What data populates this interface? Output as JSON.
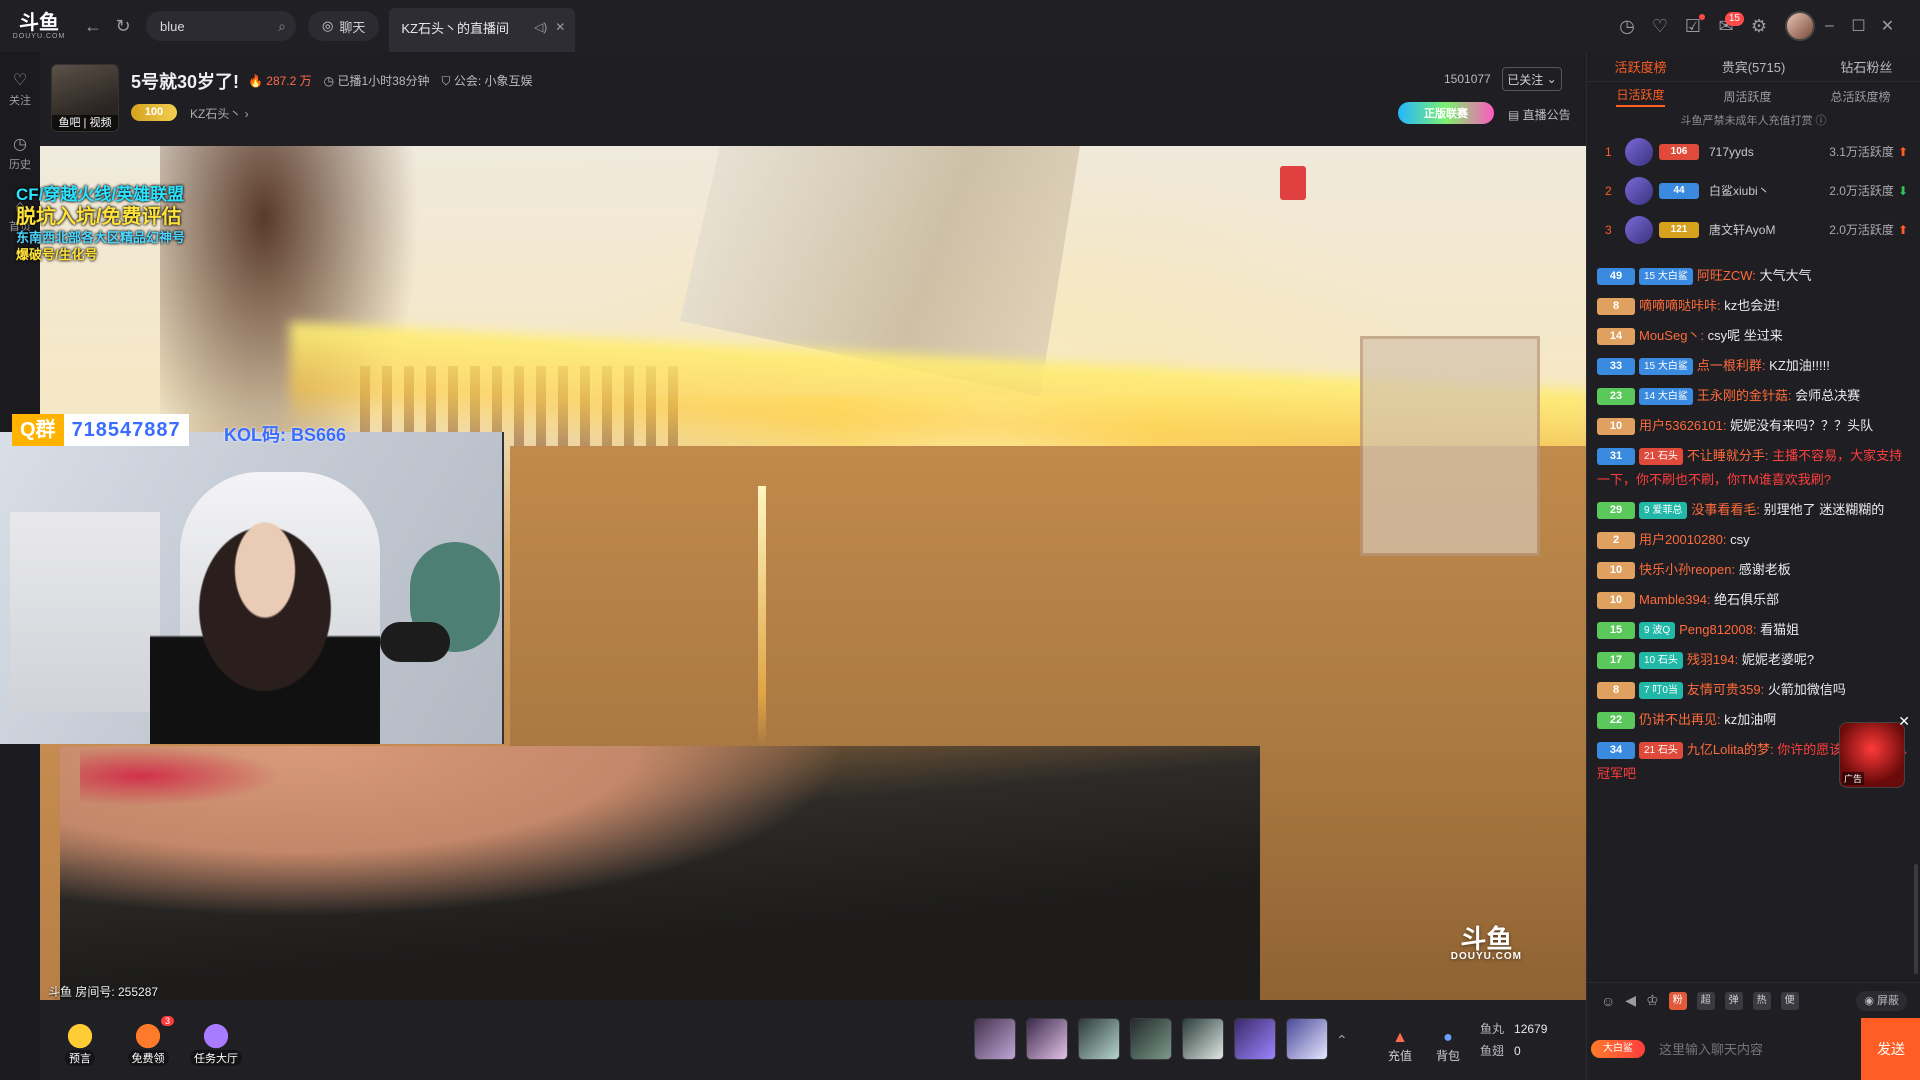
{
  "app": {
    "logo_text": "斗鱼",
    "logo_sub": "DOUYU.COM"
  },
  "topbar": {
    "search_value": "blue",
    "chat_label": "聊天",
    "tab_title": "KZ石头丶的直播间",
    "message_badge": "15"
  },
  "leftrail": [
    {
      "label": "关注",
      "icon": "heart-icon",
      "glyph": "♡"
    },
    {
      "label": "历史",
      "icon": "clock-icon",
      "glyph": "◷"
    },
    {
      "label": "首页",
      "icon": "home-icon",
      "glyph": "⌂"
    }
  ],
  "room": {
    "avatar_caption": "鱼吧 | 视频",
    "title": "5号就30岁了!",
    "hot": "287.2 万",
    "live_duration": "已播1小时38分钟",
    "guild": "公会: 小象互娱",
    "level": "100",
    "anchor": "KZ石头丶",
    "fans_count": "1501077",
    "follow_label": "已关注",
    "promo_label": "正版联赛",
    "notice_label": "直播公告",
    "room_number": "斗鱼 房间号: 255287"
  },
  "overlay": {
    "line1": "CF/穿越火线/英雄联盟",
    "line2": "脱坑入坑/免费评估",
    "line3": "东南西北部各大区精品幻神号",
    "line4": "爆破号/生化号",
    "qq_label": "Q群",
    "qq_number": "718547887",
    "kol": "KOL码: BS666"
  },
  "watermark": {
    "main": "斗鱼",
    "sub": "DOUYU.COM"
  },
  "giftbar": {
    "left": [
      {
        "label": "预言",
        "badge": ""
      },
      {
        "label": "免费领",
        "badge": "3"
      },
      {
        "label": "任务大厅",
        "badge": ""
      }
    ],
    "recharge": "充值",
    "bag": "背包",
    "fish_ball_label": "鱼丸",
    "fish_ball_value": "12679",
    "fish_fin_label": "鱼翅",
    "fish_fin_value": "0"
  },
  "side": {
    "tabs": [
      "活跃度榜",
      "贵宾(5715)",
      "钻石粉丝"
    ],
    "subtabs": [
      "日活跃度",
      "周活跃度",
      "总活跃度榜"
    ],
    "minor_notice": "斗鱼严禁未成年人充值打赏",
    "ranks": [
      {
        "no": "1",
        "level": "106",
        "name": "717yyds",
        "value": "3.1万活跃度",
        "trend": "up",
        "lvcolor": "#e04a3a"
      },
      {
        "no": "2",
        "level": "44",
        "name": "白鲨xiubi丶",
        "value": "2.0万活跃度",
        "trend": "down",
        "lvcolor": "#3a8ae0"
      },
      {
        "no": "3",
        "level": "121",
        "name": "唐文轩AyoM",
        "value": "2.0万活跃度",
        "trend": "up",
        "lvcolor": "#d6a21e"
      }
    ]
  },
  "chat": [
    {
      "lv": "49",
      "lvcolor": "#3a8ae0",
      "fan": "15 大白鲨",
      "fancolor": "blue",
      "name": "阿旺ZCW:",
      "text": "大气大气",
      "red": false
    },
    {
      "lv": "8",
      "lvcolor": "#e0a060",
      "fan": "",
      "fancolor": "",
      "name": "嘀嘀嘀哒咔咔:",
      "text": "kz也会进!",
      "red": false
    },
    {
      "lv": "14",
      "lvcolor": "#e0a060",
      "fan": "",
      "fancolor": "",
      "name": "MouSeg丶:",
      "text": "csy呢 坐过来",
      "red": false
    },
    {
      "lv": "33",
      "lvcolor": "#3a8ae0",
      "fan": "15 大白鲨",
      "fancolor": "blue",
      "name": "点一根利群:",
      "text": "KZ加油!!!!!",
      "red": false
    },
    {
      "lv": "23",
      "lvcolor": "#5ac85a",
      "fan": "14 大白鲨",
      "fancolor": "blue",
      "name": "王永刚的金针菇:",
      "text": "会师总决赛",
      "red": false
    },
    {
      "lv": "10",
      "lvcolor": "#e0a060",
      "fan": "",
      "fancolor": "",
      "name": "用户53626101:",
      "text": "妮妮没有来吗？？？头队",
      "red": false
    },
    {
      "lv": "31",
      "lvcolor": "#3a8ae0",
      "fan": "21 石头",
      "fancolor": "red",
      "name": "不让睡就分手:",
      "text": "主播不容易，大家支持一下，你不刷也不刷，你TM谁喜欢我刷?",
      "red": true
    },
    {
      "lv": "29",
      "lvcolor": "#5ac85a",
      "fan": "9 爱菲总",
      "fancolor": "teal",
      "name": "没事看看毛:",
      "text": "别理他了 迷迷糊糊的",
      "red": false
    },
    {
      "lv": "2",
      "lvcolor": "#e0a060",
      "fan": "",
      "fancolor": "",
      "name": "用户20010280:",
      "text": "csy",
      "red": false
    },
    {
      "lv": "10",
      "lvcolor": "#e0a060",
      "fan": "",
      "fancolor": "",
      "name": "快乐小孙reopen:",
      "text": "感谢老板",
      "red": false
    },
    {
      "lv": "10",
      "lvcolor": "#e0a060",
      "fan": "",
      "fancolor": "",
      "name": "Mamble394:",
      "text": "绝石俱乐部",
      "red": false
    },
    {
      "lv": "15",
      "lvcolor": "#5ac85a",
      "fan": "9 波Q",
      "fancolor": "teal",
      "name": "Peng812008:",
      "text": "看猫姐",
      "red": false
    },
    {
      "lv": "17",
      "lvcolor": "#5ac85a",
      "fan": "10 石头",
      "fancolor": "teal",
      "name": "残羽194:",
      "text": "妮妮老婆呢?",
      "red": false
    },
    {
      "lv": "8",
      "lvcolor": "#e0a060",
      "fan": "7 叮0当",
      "fancolor": "teal",
      "name": "友情可贵359:",
      "text": "火箭加微信吗",
      "red": false
    },
    {
      "lv": "22",
      "lvcolor": "#5ac85a",
      "fan": "",
      "fancolor": "",
      "name": "仍讲不出再见:",
      "text": "kz加油啊",
      "red": false
    },
    {
      "lv": "34",
      "lvcolor": "#3a8ae0",
      "fan": "21 石头",
      "fancolor": "red",
      "name": "九亿Lolita的梦:",
      "text": "你许的愿该不会是kz总冠军吧",
      "red": true
    }
  ],
  "chat_tools": {
    "shield": "屏蔽",
    "hot_btn": "粉",
    "b2": "超",
    "b3": "弹",
    "b4": "热",
    "b5": "便"
  },
  "chat_input": {
    "placeholder": "这里输入聊天内容",
    "send": "发送",
    "fans_label": "大白鲨"
  },
  "ad": {
    "tag": "广告"
  }
}
